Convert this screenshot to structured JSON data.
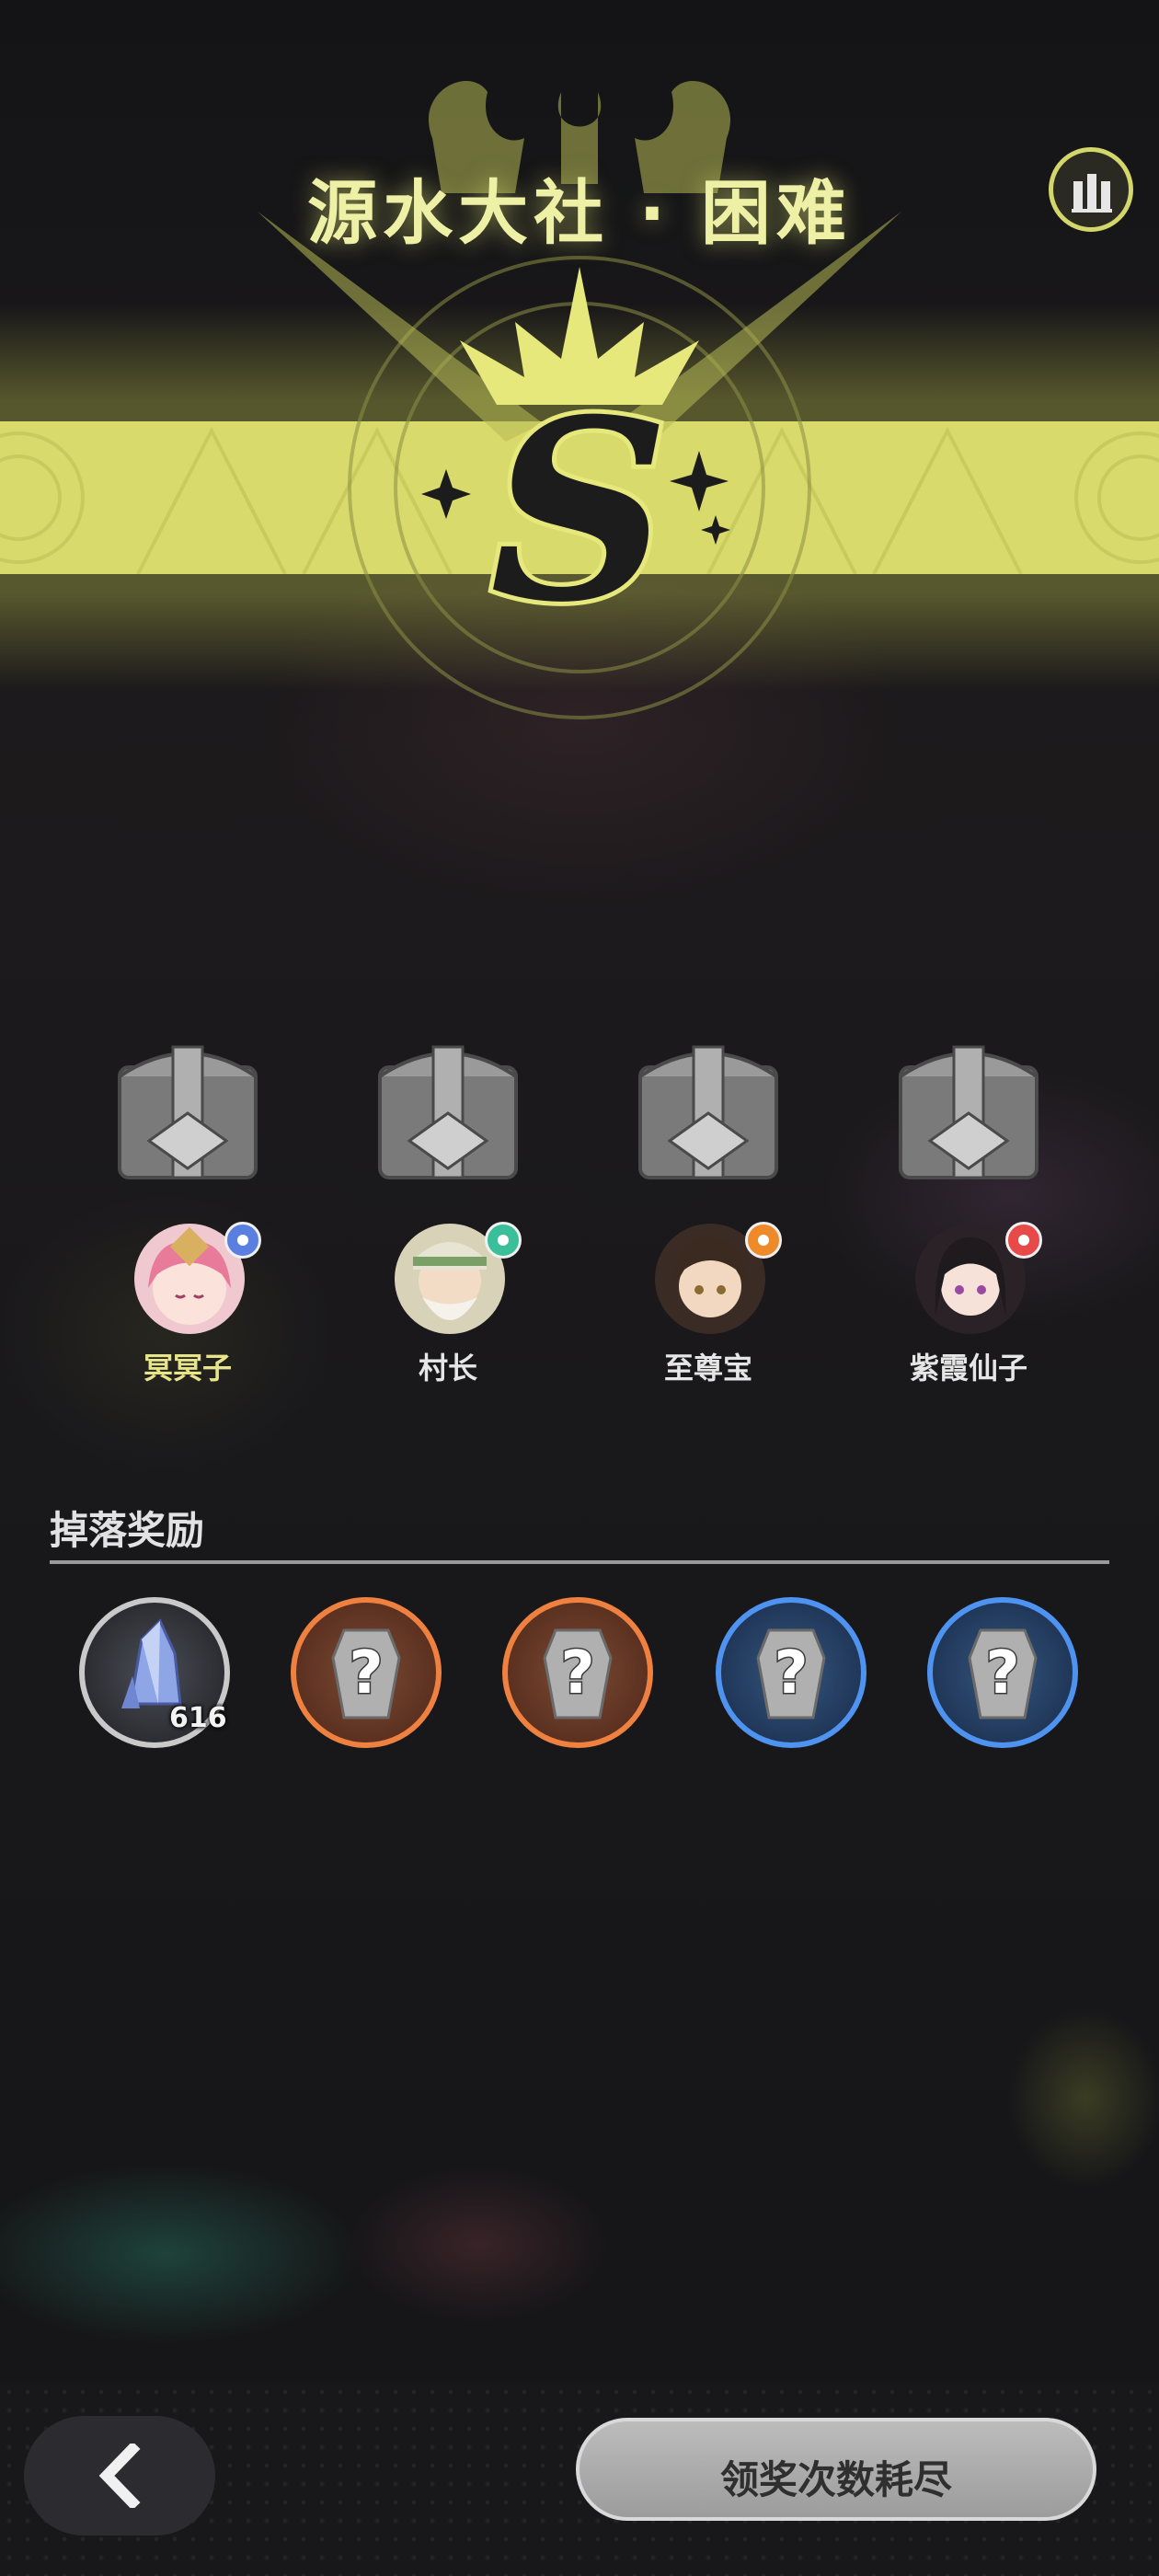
{
  "header": {
    "title": "源水大社 · 困难",
    "rank": "S"
  },
  "party": [
    {
      "name": "冥冥子",
      "element_color": "#5a7fe0",
      "highlight": true
    },
    {
      "name": "村长",
      "element_color": "#3bbf9a",
      "highlight": false
    },
    {
      "name": "至尊宝",
      "element_color": "#ee8a2a",
      "highlight": false
    },
    {
      "name": "紫霞仙子",
      "element_color": "#e84a4a",
      "highlight": false
    }
  ],
  "rewards": {
    "title": "掉落奖励",
    "items": [
      {
        "icon": "crystal-icon",
        "rarity": "white",
        "quantity": "616"
      },
      {
        "icon": "mystery-armor-icon",
        "rarity": "orange"
      },
      {
        "icon": "mystery-armor-icon",
        "rarity": "orange"
      },
      {
        "icon": "mystery-armor-icon",
        "rarity": "blue"
      },
      {
        "icon": "mystery-armor-icon",
        "rarity": "blue"
      }
    ]
  },
  "actions": {
    "claim_label": "领奖次数耗尽"
  },
  "colors": {
    "accent": "#d8da6c",
    "title": "#eef0a6"
  }
}
